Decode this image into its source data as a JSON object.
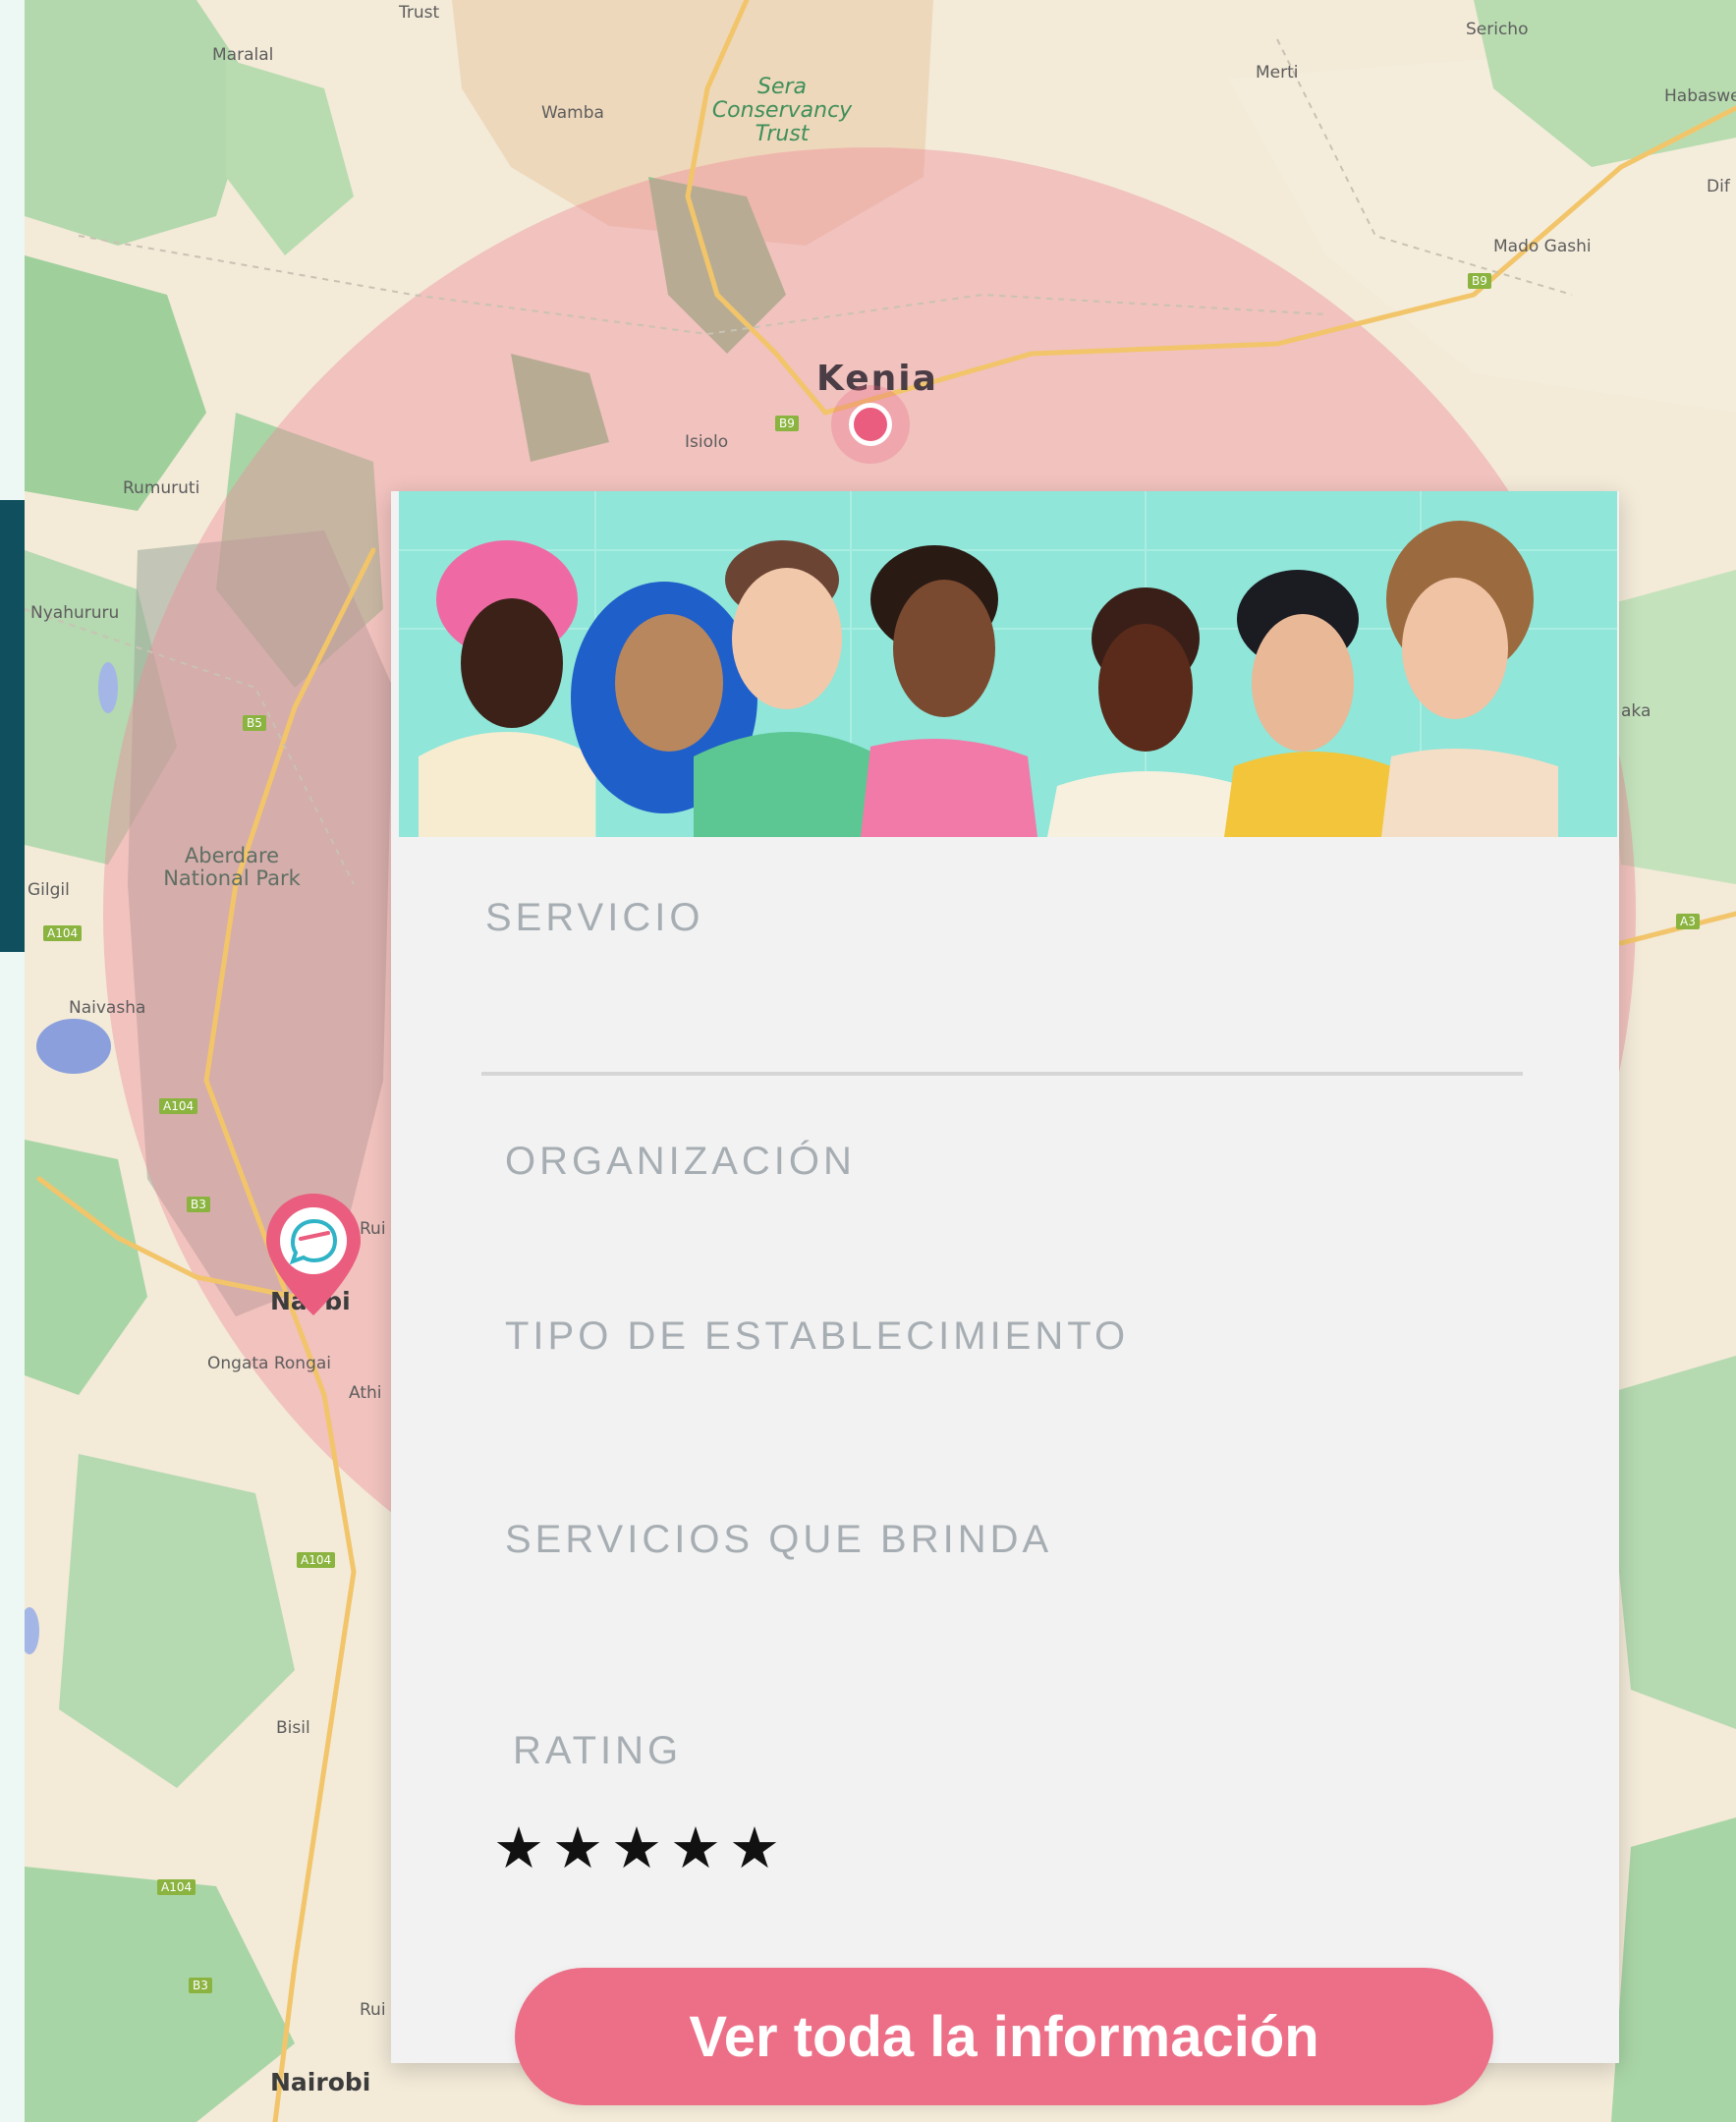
{
  "map": {
    "labels": {
      "maralal": "Maralal",
      "wamba": "Wamba",
      "sera": "Sera Conservancy Trust",
      "trust_top": "Trust",
      "merti": "Merti",
      "sericho": "Sericho",
      "habaswein": "Habaswe",
      "dif": "Dif",
      "mado_gashi": "Mado Gashi",
      "isiolo": "Isiolo",
      "rumuruti": "Rumuruti",
      "nyahururu": "Nyahururu",
      "aberdare": "Aberdare National Park",
      "gilgil": "Gilgil",
      "naivasha": "Naivasha",
      "ongata_rongai": "Ongata Rongai",
      "athi": "Athi",
      "ruiru": "Rui",
      "bisil": "Bisil",
      "nairobi_bottom": "Nairobi",
      "nairobi_pin": "Na  bi",
      "ruiru_bottom": "Rui",
      "aka": "aka"
    },
    "country_label": "Kenia",
    "roads": {
      "b9a": "B9",
      "b9b": "B9",
      "b5": "B5",
      "a104a": "A104",
      "a104b": "A104",
      "a104c": "A104",
      "b3a": "B3",
      "b3b": "B3",
      "a104d": "A104",
      "a3": "A3"
    },
    "colors": {
      "land": "#f3ead8",
      "forest": "#a8d5a6",
      "radius": "#ee8a9c",
      "accent": "#ea5d7e"
    }
  },
  "card": {
    "fields": {
      "servicio": "SERVICIO",
      "organizacion": "ORGANIZACIÓN",
      "tipo": "TIPO DE ESTABLECIMIENTO",
      "servicios": "SERVICIOS QUE BRINDA",
      "rating": "RATING"
    },
    "rating_value": 5,
    "rating_max": 5,
    "cta_label": "Ver toda la información",
    "colors": {
      "background": "#f2f2f2",
      "label": "#a7aeb3",
      "cta": "#ec6f87",
      "banner": "#8fe6d9"
    },
    "icons": {
      "star": "star-icon",
      "pin": "location-pin-icon",
      "chat": "chat-bubble-icon"
    }
  }
}
